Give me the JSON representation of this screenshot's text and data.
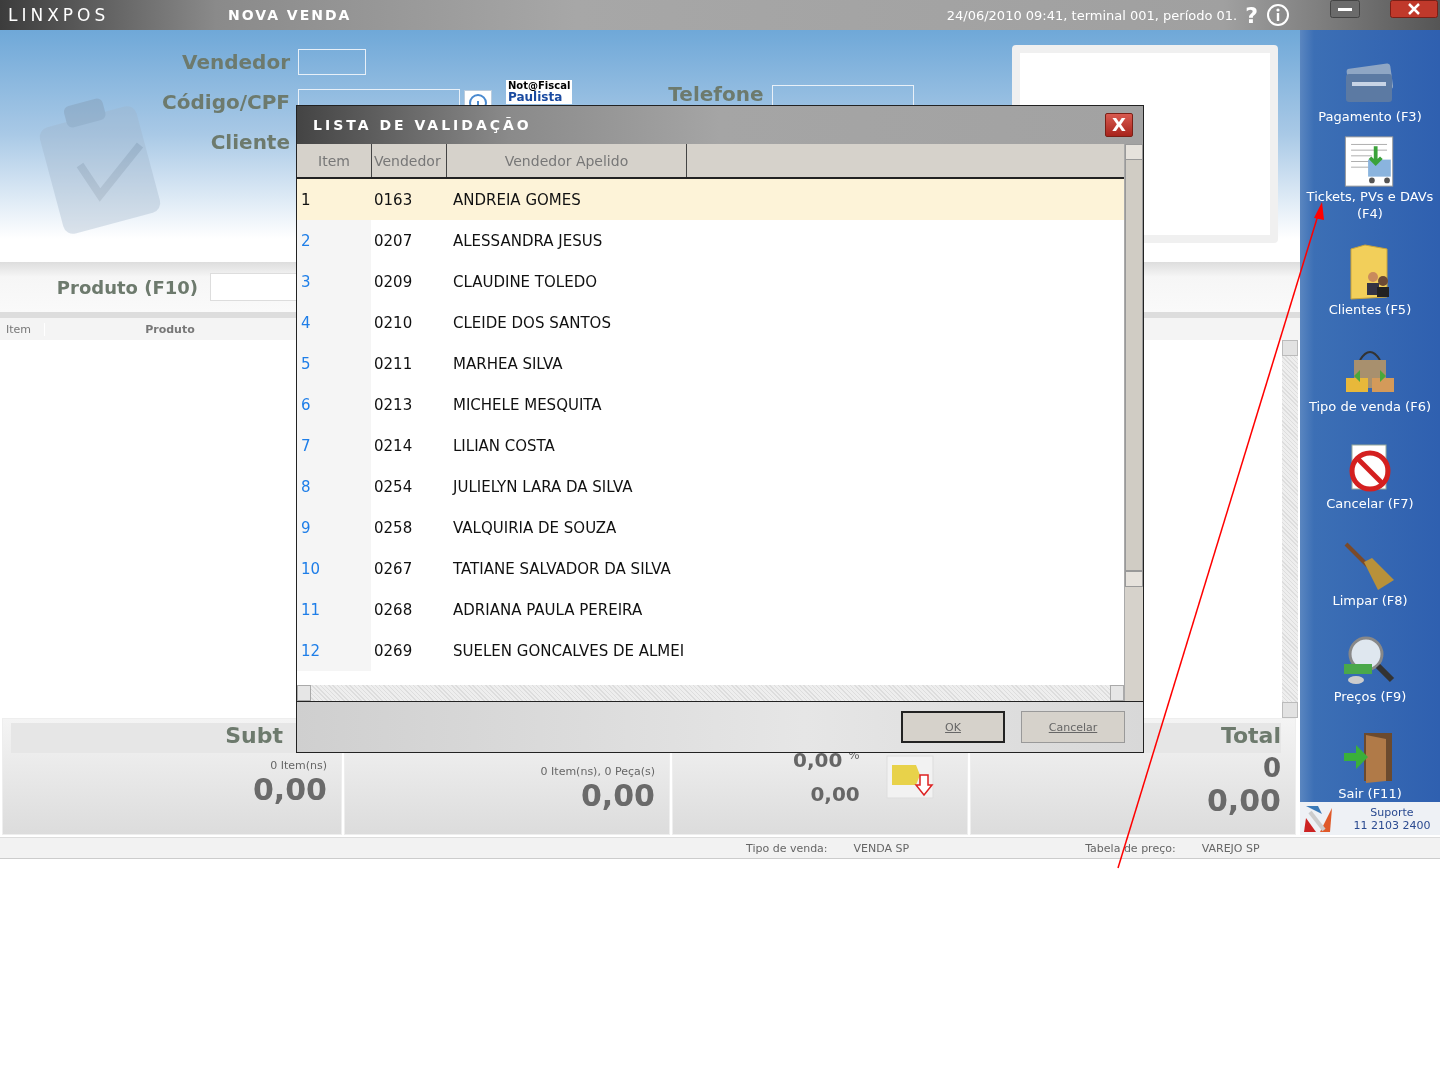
{
  "app": {
    "logo": "LINXPOS",
    "title": "NOVA VENDA",
    "status": "24/06/2010 09:41, terminal 001, período 01.",
    "help": "?"
  },
  "form": {
    "fields": [
      {
        "label": "Vendedor"
      },
      {
        "label": "Código/CPF"
      },
      {
        "label": "Cliente"
      }
    ],
    "phone_label": "Telefone",
    "badge_top": "Not@Fiscal",
    "badge_bottom": "Paulista"
  },
  "product": {
    "label": "Produto (F10)"
  },
  "grid": {
    "columns": [
      "Item",
      "Produto"
    ]
  },
  "summary": {
    "subtotal_label": "Subt",
    "subtotal_count": "0 Item(ns)",
    "subtotal_value": "0,00",
    "items_count": "0 Item(ns), 0 Peça(s)",
    "items_value": "0,00",
    "discount_percent": "0,00",
    "percent_sign": "%",
    "discount_value": "0,00",
    "total_label": "Total",
    "total_count": "0",
    "total_value": "0,00"
  },
  "sidebar": {
    "items": [
      {
        "label": "Pagamento (F3)"
      },
      {
        "label": "Tickets, PVs e DAVs (F4)"
      },
      {
        "label": "Clientes (F5)"
      },
      {
        "label": "Tipo de venda (F6)"
      },
      {
        "label": "Cancelar (F7)"
      },
      {
        "label": "Limpar (F8)"
      },
      {
        "label": "Preços (F9)"
      },
      {
        "label": "Sair (F11)"
      }
    ],
    "support_label": "Suporte",
    "support_phone": "11 2103 2400"
  },
  "status_bar": {
    "sale_type_label": "Tipo de venda:",
    "sale_type": "VENDA SP",
    "price_table_label": "Tabela de preço:",
    "price_table": "VAREJO SP"
  },
  "dialog": {
    "title": "LISTA DE VALIDAÇÃO",
    "close": "X",
    "columns": [
      "Item",
      "Vendedor",
      "Vendedor Apelido"
    ],
    "rows": [
      {
        "item": "1",
        "code": "0163",
        "name": "ANDREIA GOMES",
        "selected": true
      },
      {
        "item": "2",
        "code": "0207",
        "name": "ALESSANDRA JESUS",
        "selected": false
      },
      {
        "item": "3",
        "code": "0209",
        "name": "CLAUDINE TOLEDO",
        "selected": false
      },
      {
        "item": "4",
        "code": "0210",
        "name": "CLEIDE DOS SANTOS",
        "selected": false
      },
      {
        "item": "5",
        "code": "0211",
        "name": "MARHEA SILVA",
        "selected": false
      },
      {
        "item": "6",
        "code": "0213",
        "name": "MICHELE MESQUITA",
        "selected": false
      },
      {
        "item": "7",
        "code": "0214",
        "name": "LILIAN COSTA",
        "selected": false
      },
      {
        "item": "8",
        "code": "0254",
        "name": "JULIELYN LARA DA SILVA",
        "selected": false
      },
      {
        "item": "9",
        "code": "0258",
        "name": "VALQUIRIA DE SOUZA",
        "selected": false
      },
      {
        "item": "10",
        "code": "0267",
        "name": "TATIANE SALVADOR DA SILVA",
        "selected": false
      },
      {
        "item": "11",
        "code": "0268",
        "name": "ADRIANA PAULA PEREIRA",
        "selected": false
      },
      {
        "item": "12",
        "code": "0269",
        "name": "SUELEN GONCALVES DE ALMEI",
        "selected": false
      }
    ],
    "buttons": [
      {
        "label": "OK",
        "focused": true
      },
      {
        "label": "Cancelar",
        "focused": false
      }
    ]
  }
}
